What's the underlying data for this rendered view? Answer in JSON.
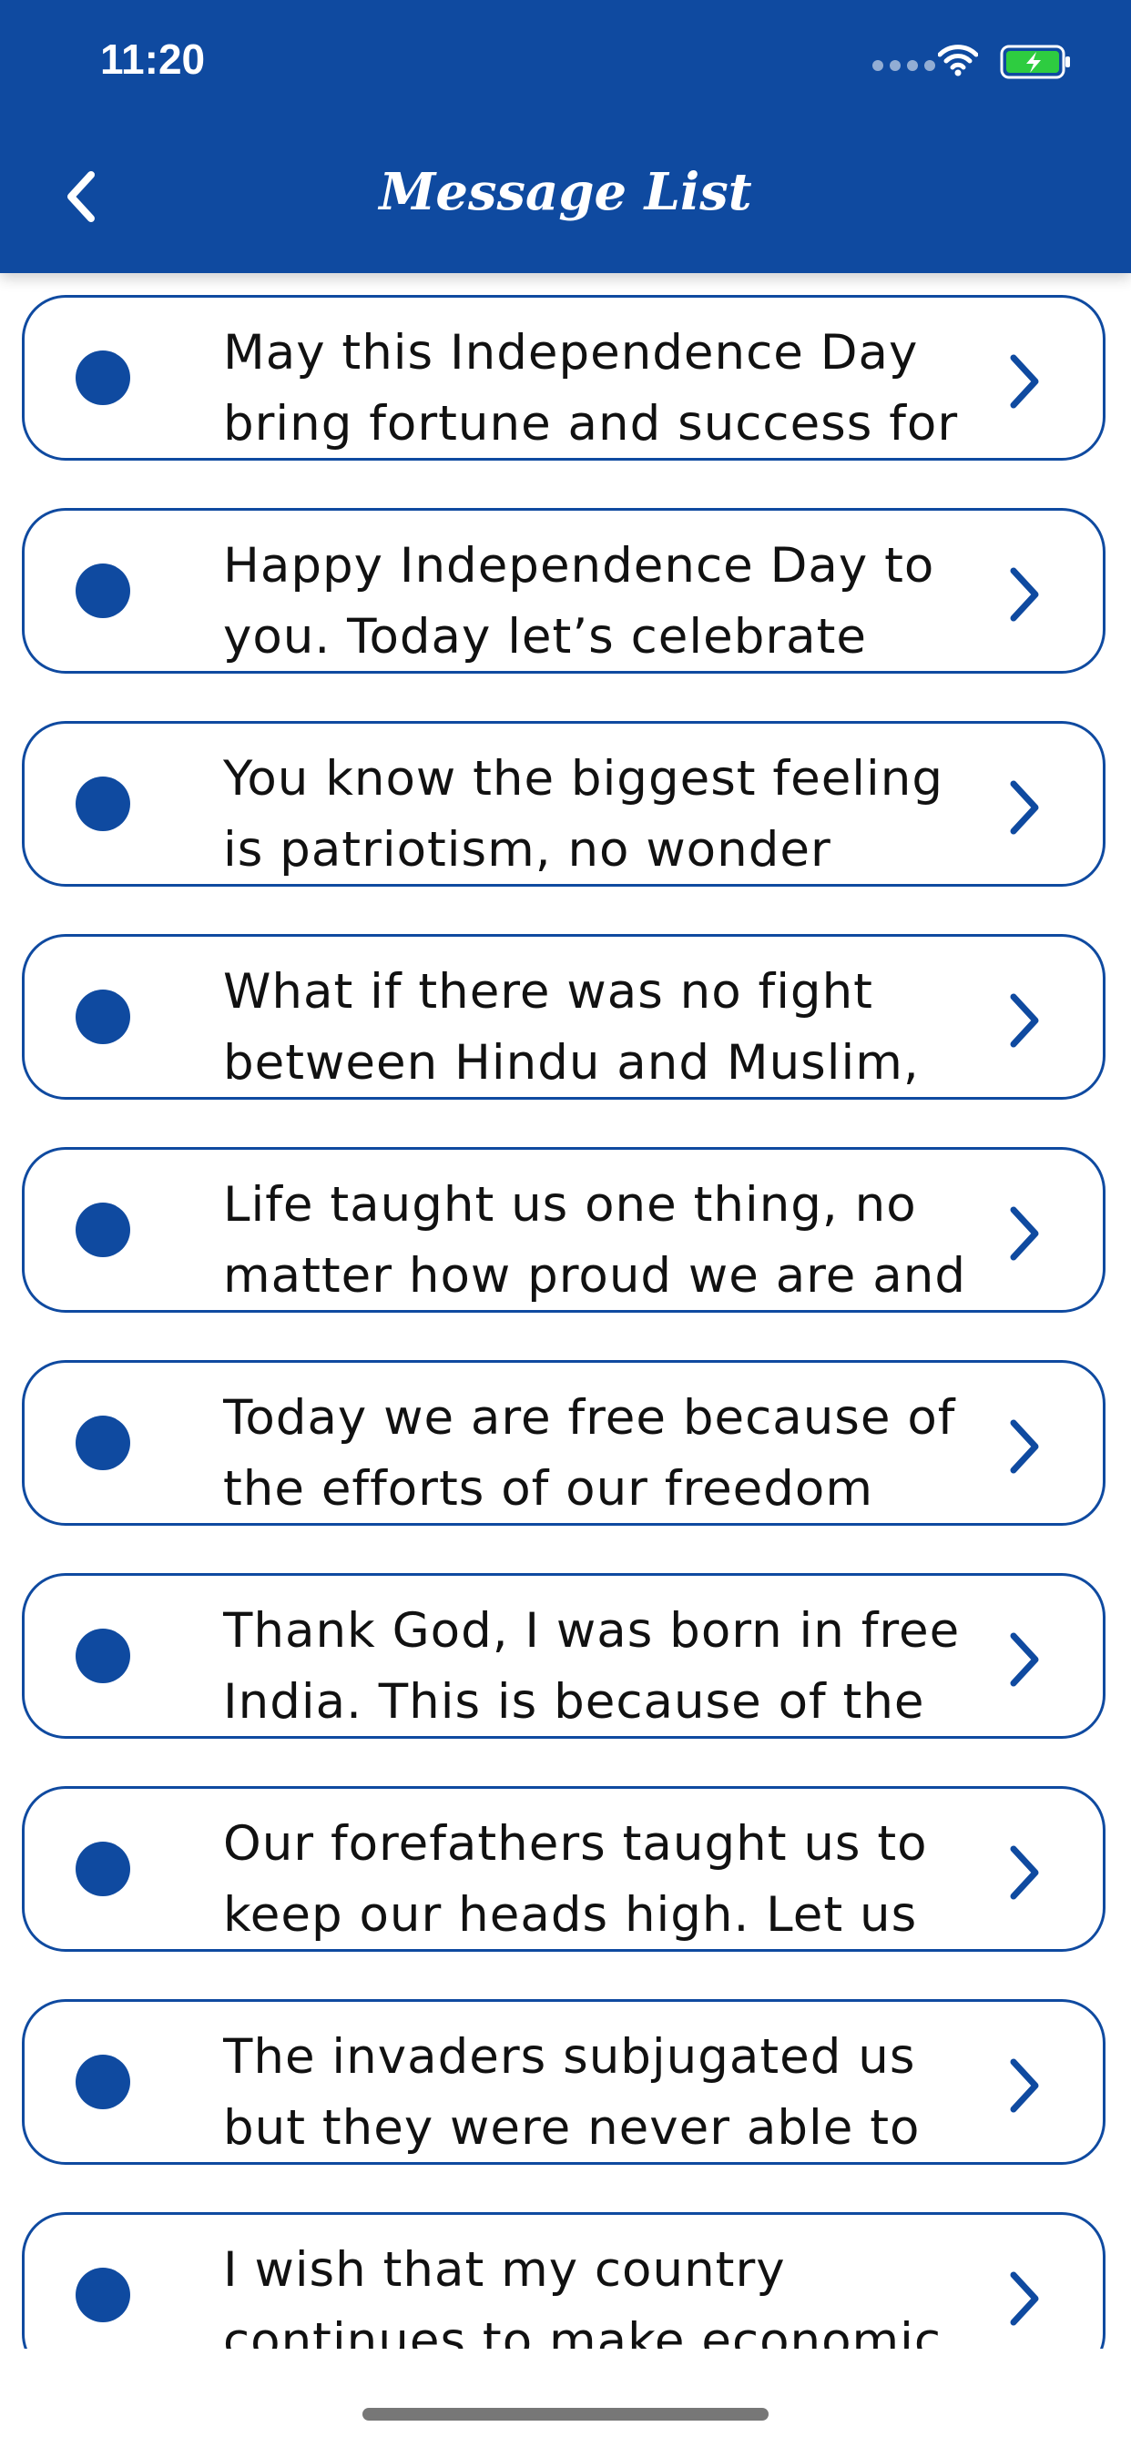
{
  "status_bar": {
    "time": "11:20"
  },
  "header": {
    "title": "Message List",
    "back_icon": "chevron-left-icon"
  },
  "colors": {
    "brand": "#0f4aa0",
    "battery": "#2ecc40",
    "text": "#111111"
  },
  "messages": [
    {
      "line1": "May this Independence Day",
      "line2": "bring fortune and success for"
    },
    {
      "line1": "Happy Independence Day to",
      "line2": "you. Today let’s celebrate"
    },
    {
      "line1": "You know the biggest feeling",
      "line2": "is patriotism, no wonder"
    },
    {
      "line1": "What if there was no fight",
      "line2": "between Hindu and Muslim,"
    },
    {
      "line1": "Life taught us one thing, no",
      "line2": "matter how proud we are and"
    },
    {
      "line1": "Today we are free because of",
      "line2": "the efforts of our freedom"
    },
    {
      "line1": "Thank God, I was born in free",
      "line2": "India. This is because of the"
    },
    {
      "line1": "Our forefathers taught us to",
      "line2": "keep our heads high. Let us"
    },
    {
      "line1": "The invaders subjugated us",
      "line2": "but they were never able to"
    },
    {
      "line1": "I wish that my country",
      "line2": "continues to make economic"
    }
  ]
}
